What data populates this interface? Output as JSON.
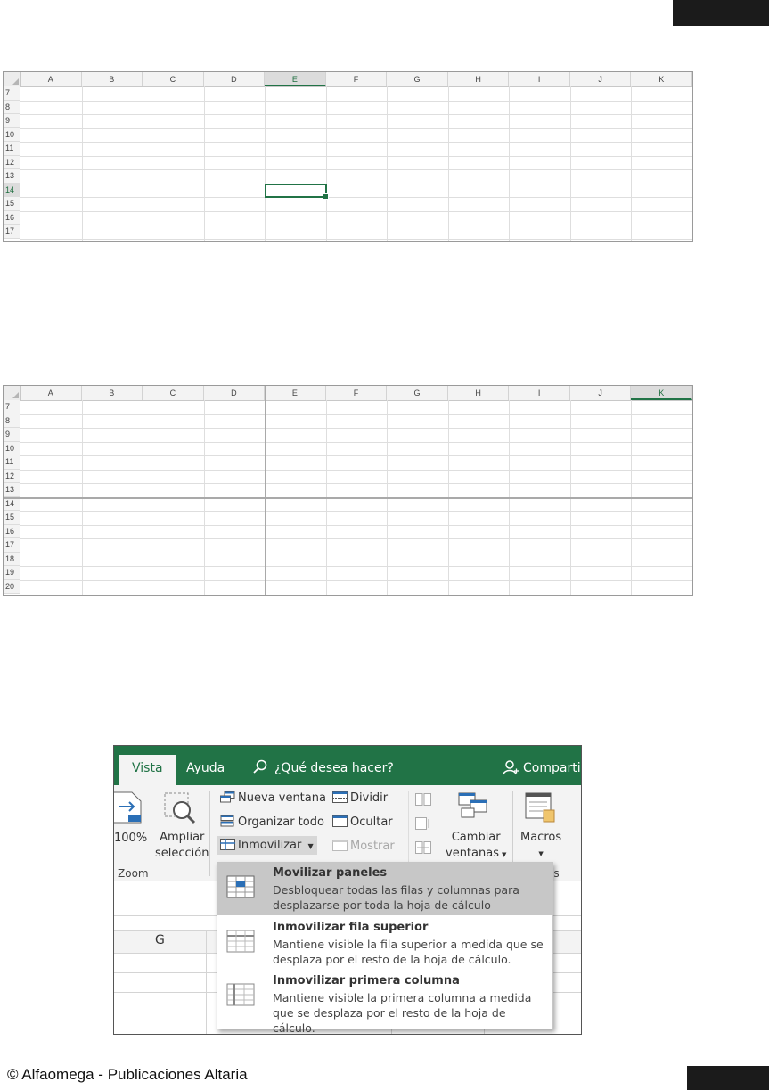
{
  "sheet1": {
    "columns": [
      "A",
      "B",
      "C",
      "D",
      "E",
      "F",
      "G",
      "H",
      "I",
      "J",
      "K"
    ],
    "rows": [
      "7",
      "8",
      "9",
      "10",
      "11",
      "12",
      "13",
      "14",
      "15",
      "16",
      "17"
    ],
    "selected_column": "E",
    "selected_row": "14"
  },
  "sheet2": {
    "columns": [
      "A",
      "B",
      "C",
      "D",
      "E",
      "F",
      "G",
      "H",
      "I",
      "J",
      "K"
    ],
    "rows": [
      "7",
      "8",
      "9",
      "10",
      "11",
      "12",
      "13",
      "14",
      "15",
      "16",
      "17",
      "18",
      "19",
      "20"
    ],
    "selected_column": "K"
  },
  "ribbon": {
    "tabs": {
      "vista": "Vista",
      "ayuda": "Ayuda"
    },
    "search_placeholder": "¿Qué desea hacer?",
    "share": "Compartir",
    "zoom100": "100%",
    "ampliar1": "Ampliar",
    "ampliar2": "selección",
    "zoom_group": "Zoom",
    "nueva_ventana": "Nueva ventana",
    "organizar_todo": "Organizar todo",
    "inmovilizar": "Inmovilizar",
    "dividir": "Dividir",
    "ocultar": "Ocultar",
    "mostrar": "Mostrar",
    "cambiar1": "Cambiar",
    "cambiar2": "ventanas",
    "macros": "Macros",
    "macros_group_fragment": "os",
    "sheet_col_g": "G"
  },
  "menu": {
    "items": [
      {
        "title": "Movilizar paneles",
        "desc": "Desbloquear todas las filas y columnas para desplazarse por toda la hoja de cálculo"
      },
      {
        "title": "Inmovilizar fila superior",
        "desc": "Mantiene visible la fila superior a medida que se desplaza por el resto de la hoja de cálculo."
      },
      {
        "title": "Inmovilizar primera columna",
        "desc": "Mantiene visible la primera columna a medida que se desplaza por el resto de la hoja de cálculo."
      }
    ]
  },
  "footer": {
    "text": "© Alfaomega - Publicaciones Altaria"
  }
}
